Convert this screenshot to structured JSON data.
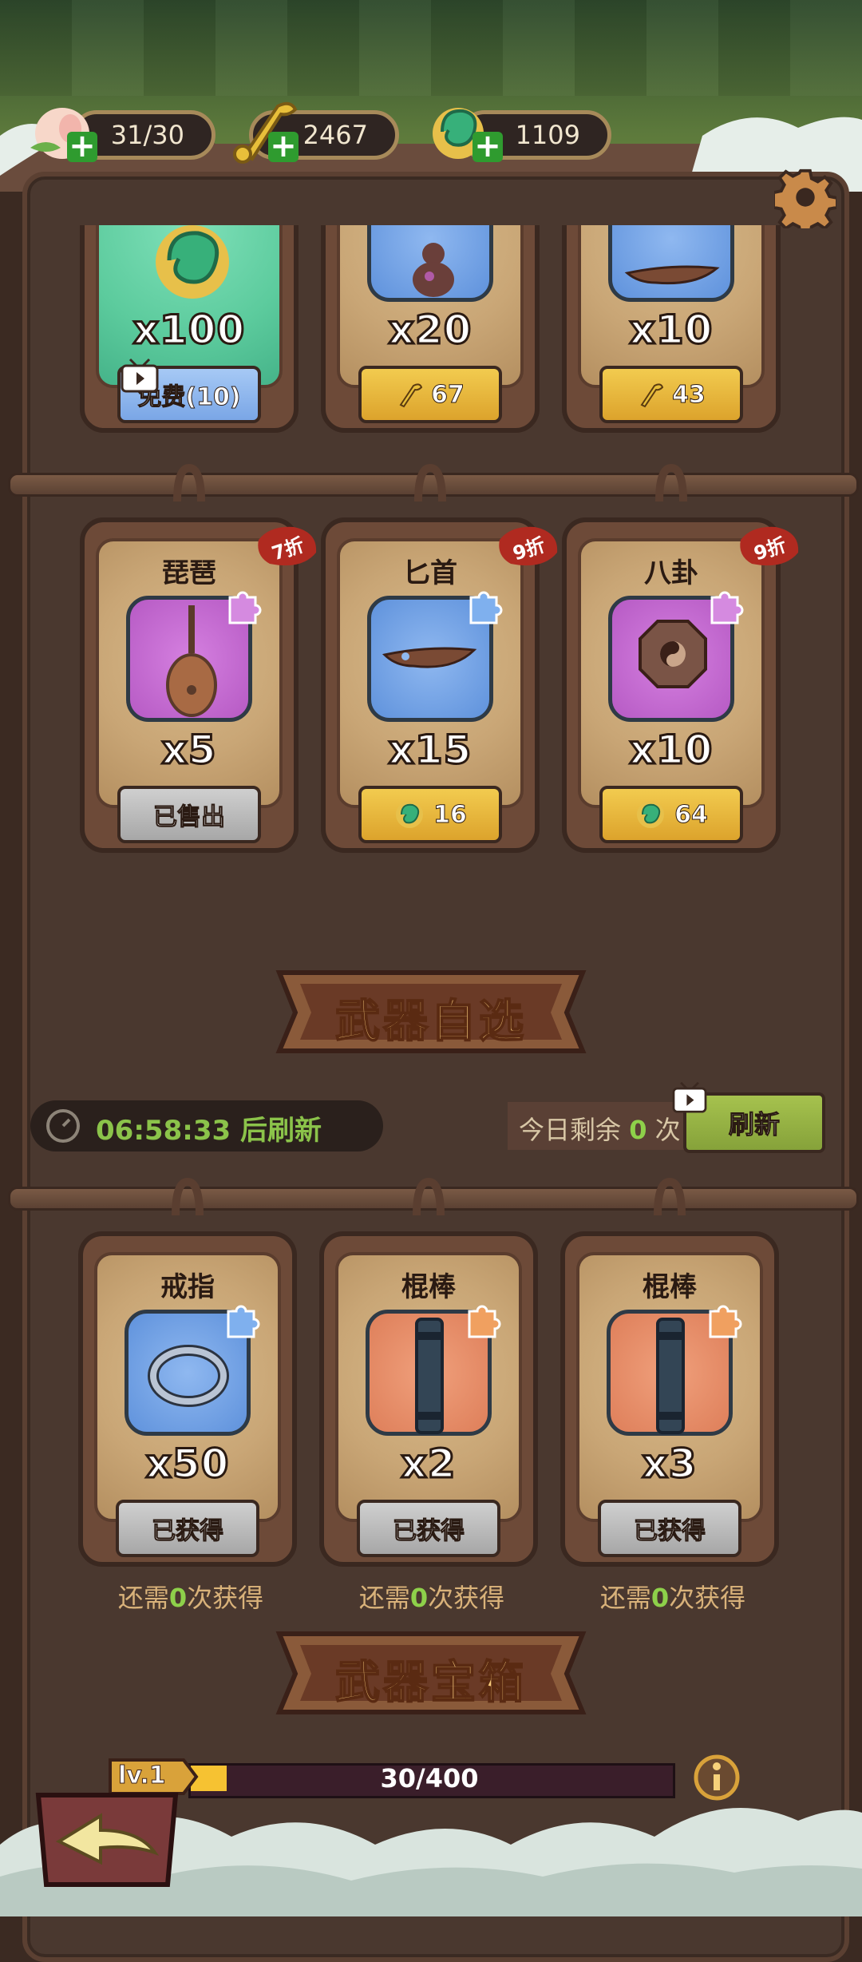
{
  "resources": [
    {
      "name": "peach",
      "value": "31/30"
    },
    {
      "name": "ruyi",
      "value": "2467"
    },
    {
      "name": "jade",
      "value": "1109"
    }
  ],
  "top_row": [
    {
      "qty": "x100",
      "button": "免费(10)",
      "button_style": "blue",
      "has_tv": true
    },
    {
      "qty": "x20",
      "button": "67",
      "button_style": "gold",
      "currency": "ruyi-icon"
    },
    {
      "qty": "x10",
      "button": "43",
      "button_style": "gold",
      "currency": "ruyi-icon"
    }
  ],
  "shop_row": [
    {
      "name": "琵琶",
      "qty": "x5",
      "discount": "7折",
      "button": "已售出",
      "button_style": "gray",
      "frame": "purple",
      "puzzle": "purple"
    },
    {
      "name": "匕首",
      "qty": "x15",
      "discount": "9折",
      "button": "16",
      "button_style": "gold",
      "frame": "blue",
      "puzzle": "blue",
      "currency": "jade-icon"
    },
    {
      "name": "八卦",
      "qty": "x10",
      "discount": "9折",
      "button": "64",
      "button_style": "gold",
      "frame": "purple",
      "puzzle": "purple",
      "currency": "jade-icon"
    }
  ],
  "weapon_select": {
    "banner": "武器自选",
    "timer_time": "06:58:33",
    "timer_suffix": " 后刷新",
    "remain_prefix": "今日剩余 ",
    "remain_count": "0",
    "remain_suffix": " 次",
    "refresh_button": "刷新"
  },
  "select_row": [
    {
      "name": "戒指",
      "qty": "x50",
      "button": "已获得",
      "frame": "blue",
      "puzzle": "blue",
      "need_prefix": "还需",
      "need_count": "0",
      "need_suffix": "次获得"
    },
    {
      "name": "棍棒",
      "qty": "x2",
      "button": "已获得",
      "frame": "orange",
      "puzzle": "orange",
      "need_prefix": "还需",
      "need_count": "0",
      "need_suffix": "次获得"
    },
    {
      "name": "棍棒",
      "qty": "x3",
      "button": "已获得",
      "frame": "orange",
      "puzzle": "orange",
      "need_prefix": "还需",
      "need_count": "0",
      "need_suffix": "次获得"
    }
  ],
  "chest": {
    "banner": "武器宝箱",
    "level": "lv.1",
    "progress_text": "30/400",
    "progress_current": 30,
    "progress_max": 400
  },
  "colors": {
    "accent_gold": "#f2cb4f",
    "accent_green": "#8ed04a",
    "frame_brown": "#4a382f"
  }
}
